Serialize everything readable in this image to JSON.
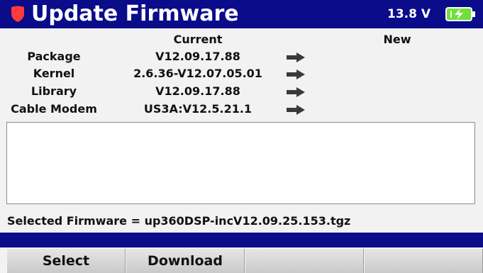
{
  "header": {
    "title": "Update Firmware",
    "voltage": "13.8 V",
    "brand_color": "#0a0c8a",
    "shield_color": "#ff3b3b",
    "battery_color": "#6fe03a"
  },
  "columns": {
    "current": "Current",
    "new": "New"
  },
  "rows": [
    {
      "label": "Package",
      "current": "V12.09.17.88",
      "new": ""
    },
    {
      "label": "Kernel",
      "current": "2.6.36-V12.07.05.01",
      "new": ""
    },
    {
      "label": "Library",
      "current": "V12.09.17.88",
      "new": ""
    },
    {
      "label": "Cable Modem",
      "current": "US3A:V12.5.21.1",
      "new": ""
    }
  ],
  "message_box": {
    "text": ""
  },
  "selected_firmware": "Selected Firmware = up360DSP-incV12.09.25.153.tgz",
  "softkeys": [
    "Select",
    "Download",
    "",
    ""
  ]
}
